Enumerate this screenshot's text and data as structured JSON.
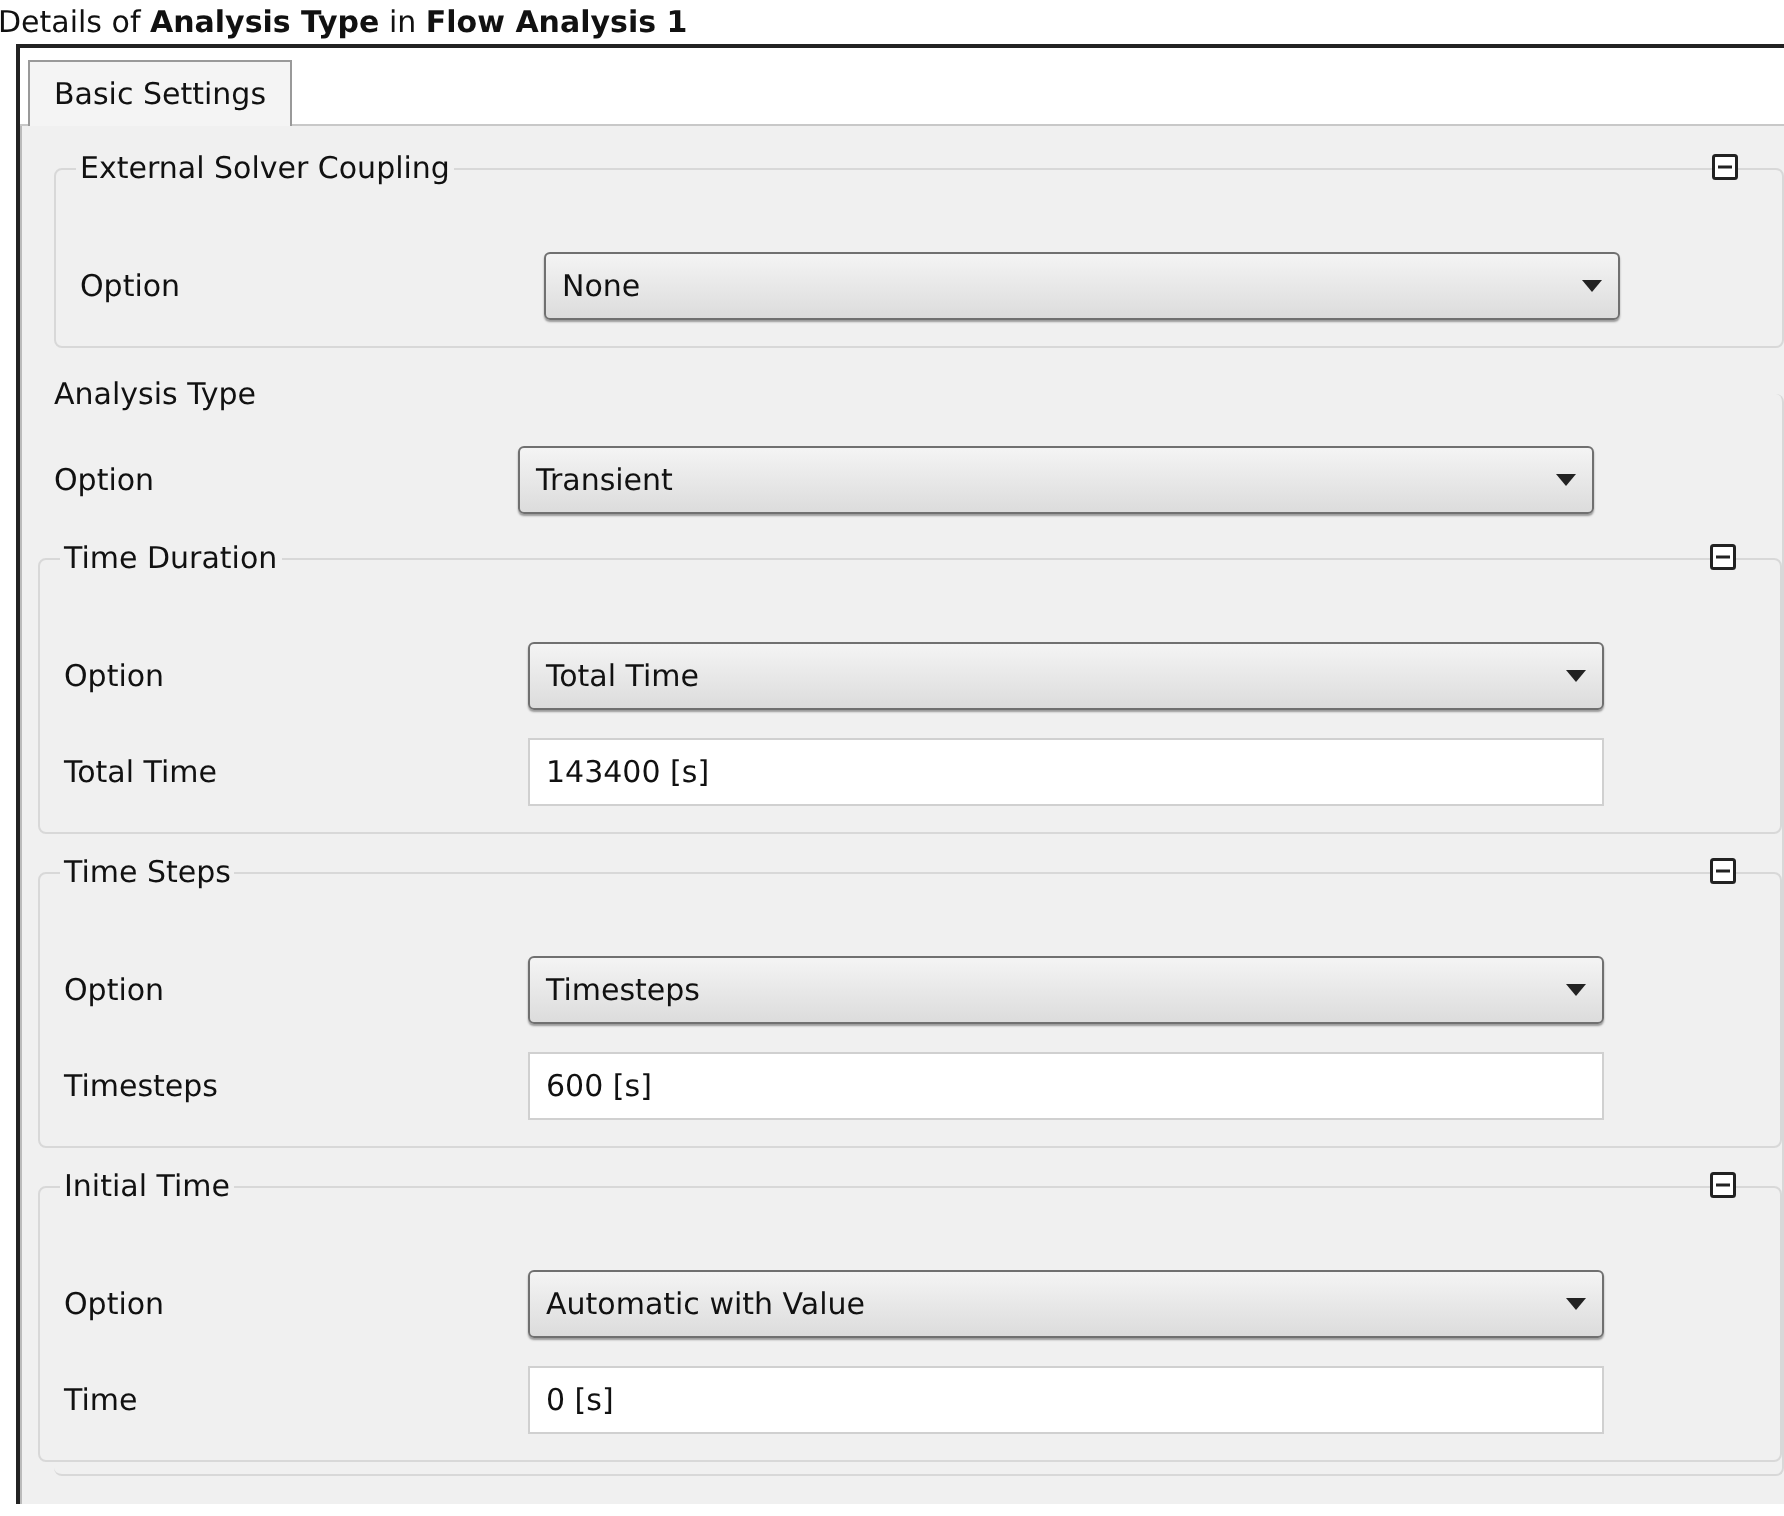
{
  "title": "Details of **Analysis Type** in **Flow Analysis 1**",
  "tabs": [
    {
      "label": "Basic Settings",
      "selected": true
    }
  ],
  "sections": [
    {
      "title": "External Solver Coupling",
      "collapsible": true,
      "rows": [
        {
          "label": "Option",
          "kind": "dropdown",
          "value": "None"
        }
      ]
    },
    {
      "title": "Analysis Type",
      "collapsible": false,
      "rows": [
        {
          "label": "Option",
          "kind": "dropdown",
          "value": "Transient"
        }
      ],
      "subsections": [
        {
          "title": "Time Duration",
          "collapsible": true,
          "rows": [
            {
              "label": "Option",
              "kind": "dropdown",
              "value": "Total Time"
            },
            {
              "label": "Total Time",
              "kind": "text",
              "value": "143400 [s]"
            }
          ]
        },
        {
          "title": "Time Steps",
          "collapsible": true,
          "rows": [
            {
              "label": "Option",
              "kind": "dropdown",
              "value": "Timesteps"
            },
            {
              "label": "Timesteps",
              "kind": "text",
              "value": "600 [s]"
            }
          ]
        },
        {
          "title": "Initial Time",
          "collapsible": true,
          "rows": [
            {
              "label": "Option",
              "kind": "dropdown",
              "value": "Automatic with Value"
            },
            {
              "label": "Time",
              "kind": "text",
              "value": "0 [s]"
            }
          ]
        }
      ]
    }
  ]
}
